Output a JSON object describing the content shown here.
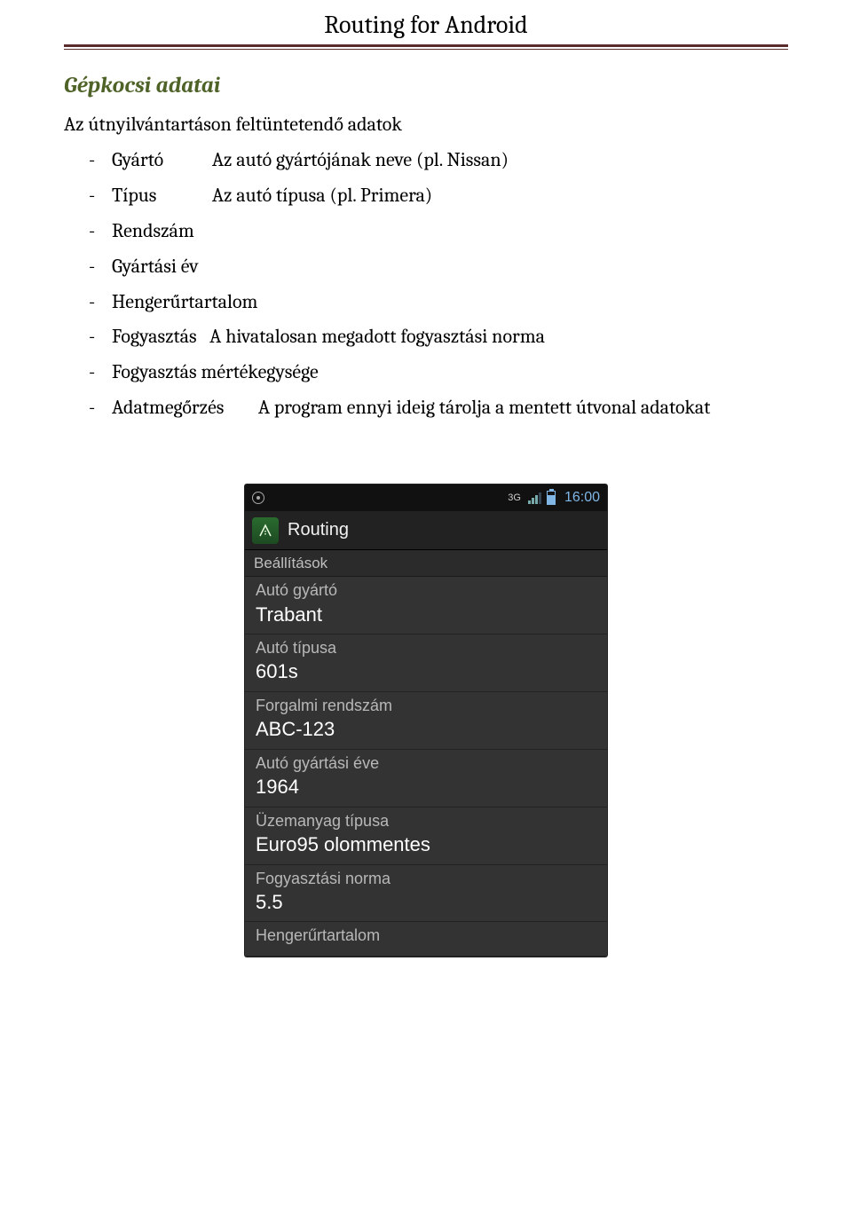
{
  "header": {
    "title": "Routing for Android"
  },
  "section": {
    "heading": "Gépkocsi adatai",
    "intro": "Az útnyilvántartáson feltüntetendő adatok",
    "items": [
      {
        "label": "Gyártó",
        "desc": "Az autó gyártójának neve (pl. Nissan)"
      },
      {
        "label": "Típus",
        "desc": "Az autó típusa (pl. Primera)"
      },
      {
        "label": "Rendszám",
        "desc": ""
      },
      {
        "label": "Gyártási év",
        "desc": ""
      },
      {
        "label": "Hengerűrtartalom",
        "desc": ""
      },
      {
        "label": "Fogyasztás",
        "desc": "A hivatalosan megadott fogyasztási norma"
      },
      {
        "label": "Fogyasztás mértékegysége",
        "desc": ""
      },
      {
        "label": "Adatmegőrzés",
        "desc": "A program ennyi ideig tárolja a mentett útvonal adatokat"
      }
    ]
  },
  "phone": {
    "status": {
      "network": "3G",
      "time": "16:00"
    },
    "app_title": "Routing",
    "section_label": "Beállítások",
    "settings": [
      {
        "k": "Autó gyártó",
        "v": "Trabant"
      },
      {
        "k": "Autó típusa",
        "v": "601s"
      },
      {
        "k": "Forgalmi rendszám",
        "v": "ABC-123"
      },
      {
        "k": "Autó gyártási éve",
        "v": "1964"
      },
      {
        "k": "Üzemanyag típusa",
        "v": "Euro95 olommentes"
      },
      {
        "k": "Fogyasztási norma",
        "v": "5.5"
      },
      {
        "k": "Hengerűrtartalom",
        "v": ""
      }
    ]
  }
}
